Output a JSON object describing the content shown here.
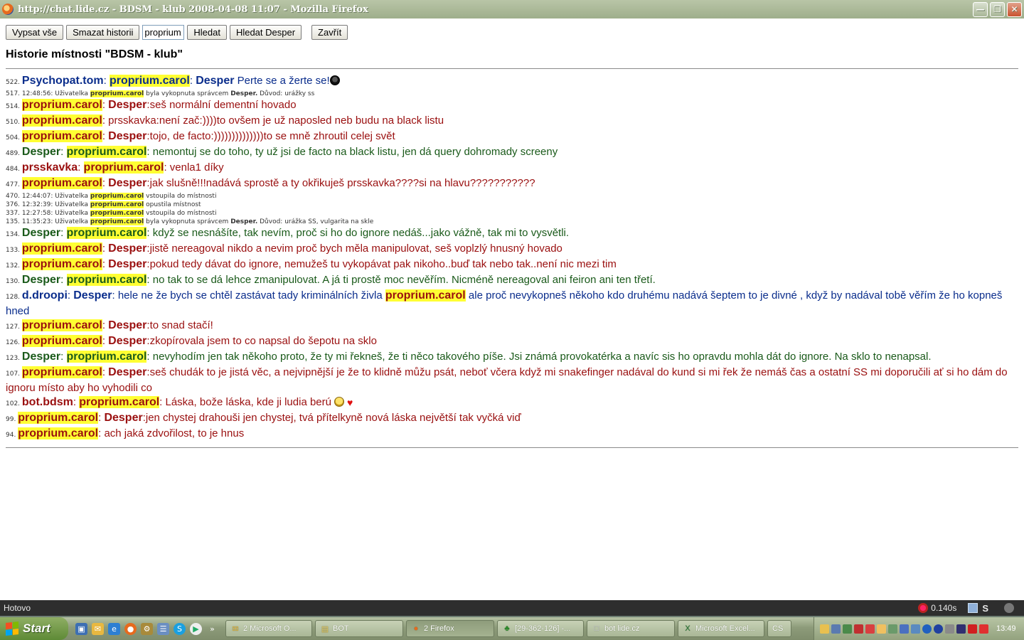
{
  "window": {
    "title": "http://chat.lide.cz - BDSM - klub 2008-04-08 11:07 - Mozilla Firefox"
  },
  "toolbar": {
    "show_all": "Vypsat vše",
    "clear_history": "Smazat historii",
    "search_value": "proprium.carol",
    "find": "Hledat",
    "find_desper": "Hledat Desper",
    "close": "Zavřít"
  },
  "page": {
    "title": "Historie místnosti \"BDSM - klub\""
  },
  "messages": [
    {
      "n": "522.",
      "from": "Psychopat.tom",
      "to": "proprium.carol",
      "to2": "Desper",
      "text": " Perte se a žerte se!",
      "emo": "dark"
    },
    {
      "sys": true,
      "n": "517.",
      "time": "12:48:56:",
      "pre": "Uživatelka",
      "name": "proprium.carol",
      "rest": "byla vykopnuta správcem",
      "by": "Desper.",
      "reason": "Důvod: urážky ss"
    },
    {
      "n": "514.",
      "from": "proprium.carol",
      "to": "Desper",
      "text": "seš normální dementní hovado"
    },
    {
      "n": "510.",
      "from": "proprium.carol",
      "text": "prsskavka:není zač:))))to ovšem je už naposled neb budu na black listu"
    },
    {
      "n": "504.",
      "from": "proprium.carol",
      "to": "Desper",
      "text": "tojo, de facto:))))))))))))))to se mně zhroutil celej svět"
    },
    {
      "n": "489.",
      "from": "Desper",
      "to": "proprium.carol",
      "text": " nemontuj se do toho, ty už jsi de facto na black listu, jen dá query dohromady screeny"
    },
    {
      "n": "484.",
      "from": "prsskavka",
      "to": "proprium.carol",
      "text": " venla1 díky"
    },
    {
      "n": "477.",
      "from": "proprium.carol",
      "to": "Desper",
      "text": "jak slušně!!!nadává sprostě a ty okřikuješ prsskavka????si na hlavu???????????"
    },
    {
      "sys": true,
      "n": "470.",
      "time": "12:44:07:",
      "pre": "Uživatelka",
      "name": "proprium.carol",
      "rest": "vstoupila do místnosti"
    },
    {
      "sys": true,
      "n": "376.",
      "time": "12:32:39:",
      "pre": "Uživatelka",
      "name": "proprium.carol",
      "rest": "opustila místnost"
    },
    {
      "sys": true,
      "n": "337.",
      "time": "12:27:58:",
      "pre": "Uživatelka",
      "name": "proprium.carol",
      "rest": "vstoupila do místnosti"
    },
    {
      "sys": true,
      "n": "135.",
      "time": "11:35:23:",
      "pre": "Uživatelka",
      "name": "proprium.carol",
      "rest": "byla vykopnuta správcem",
      "by": "Desper.",
      "reason": "Důvod: urážka SS, vulgarita na skle"
    },
    {
      "n": "134.",
      "from": "Desper",
      "to": "proprium.carol",
      "text": " když se nesnášíte, tak nevím, proč si ho do ignore nedáš...jako vážně, tak mi to vysvětli."
    },
    {
      "n": "133.",
      "from": "proprium.carol",
      "to": "Desper",
      "text": "jistě nereagoval nikdo a nevim proč bych měla manipulovat, seš voplzlý hnusný hovado"
    },
    {
      "n": "132.",
      "from": "proprium.carol",
      "to": "Desper",
      "text": "pokud tedy dávat do ignore, nemužeš tu vykopávat pak nikoho..buď tak nebo tak..není nic mezi tim"
    },
    {
      "n": "130.",
      "from": "Desper",
      "to": "proprium.carol",
      "text": " no tak to se dá lehce zmanipulovat. A já ti prostě moc nevěřím. Nicméně nereagoval ani feiron ani ten třetí."
    },
    {
      "n": "128.",
      "from": "d.droopi",
      "to": "Desper",
      "text": " hele ne že bych se chtěl zastávat tady kriminálních živla ",
      "mid": "proprium.carol",
      "text2": " ale proč nevykopneš někoho kdo druhému nadává šeptem to je divné , když by nadával tobě věřím že ho kopneš hned"
    },
    {
      "n": "127.",
      "from": "proprium.carol",
      "to": "Desper",
      "text": "to snad stačí!"
    },
    {
      "n": "126.",
      "from": "proprium.carol",
      "to": "Desper",
      "text": "zkopírovala jsem to co napsal do šepotu na sklo"
    },
    {
      "n": "123.",
      "from": "Desper",
      "to": "proprium.carol",
      "text": " nevyhodím jen tak někoho proto, že ty mi řekneš, že ti něco takového píše. Jsi známá provokatérka a navíc sis ho opravdu mohla dát do ignore. Na sklo to nenapsal."
    },
    {
      "n": "107.",
      "from": "proprium.carol",
      "to": "Desper",
      "text": "seš chudák to je jistá věc, a nejvipnější je že to klidně můžu psát, neboť včera když mi snakefinger nadával do kund si mi řek že nemáš čas a ostatní SS mi doporučili ať si ho dám do ignoru místo aby ho vyhodili co"
    },
    {
      "n": "102.",
      "from": "bot.bdsm",
      "to": "proprium.carol",
      "text": " Láska, bože láska, kde ji ludia berú ",
      "emo": "laugh-heart"
    },
    {
      "n": "99.",
      "from": "proprium.carol",
      "to": "Desper",
      "text": "jen chystej drahouši jen chystej, tvá přítelkyně nová láska největší tak vyčká viď"
    },
    {
      "n": "94.",
      "from": "proprium.carol",
      "text": " ach jaká zdvořilost, to je hnus"
    }
  ],
  "statusbar": {
    "text": "Hotovo",
    "timing": "0.140s",
    "s_label": "S"
  },
  "taskbar": {
    "start": "Start",
    "tasks": [
      {
        "label": "2 Microsoft O...",
        "icon": "outlook-icon"
      },
      {
        "label": "BOT",
        "icon": "folder-icon"
      },
      {
        "label": "2 Firefox",
        "icon": "firefox-icon",
        "active": true
      },
      {
        "label": "[29-362-126] -...",
        "icon": "clover-icon"
      },
      {
        "label": "bot lide.cz",
        "icon": "document-icon"
      },
      {
        "label": "Microsoft Excel...",
        "icon": "excel-icon"
      },
      {
        "label": "CS",
        "icon": "language-icon"
      }
    ],
    "clock": "13:49"
  },
  "colors": {
    "highlight": "#ffff33",
    "blue": "#0a2d8c",
    "red": "#9a0f0f",
    "green": "#1a5a1a"
  }
}
